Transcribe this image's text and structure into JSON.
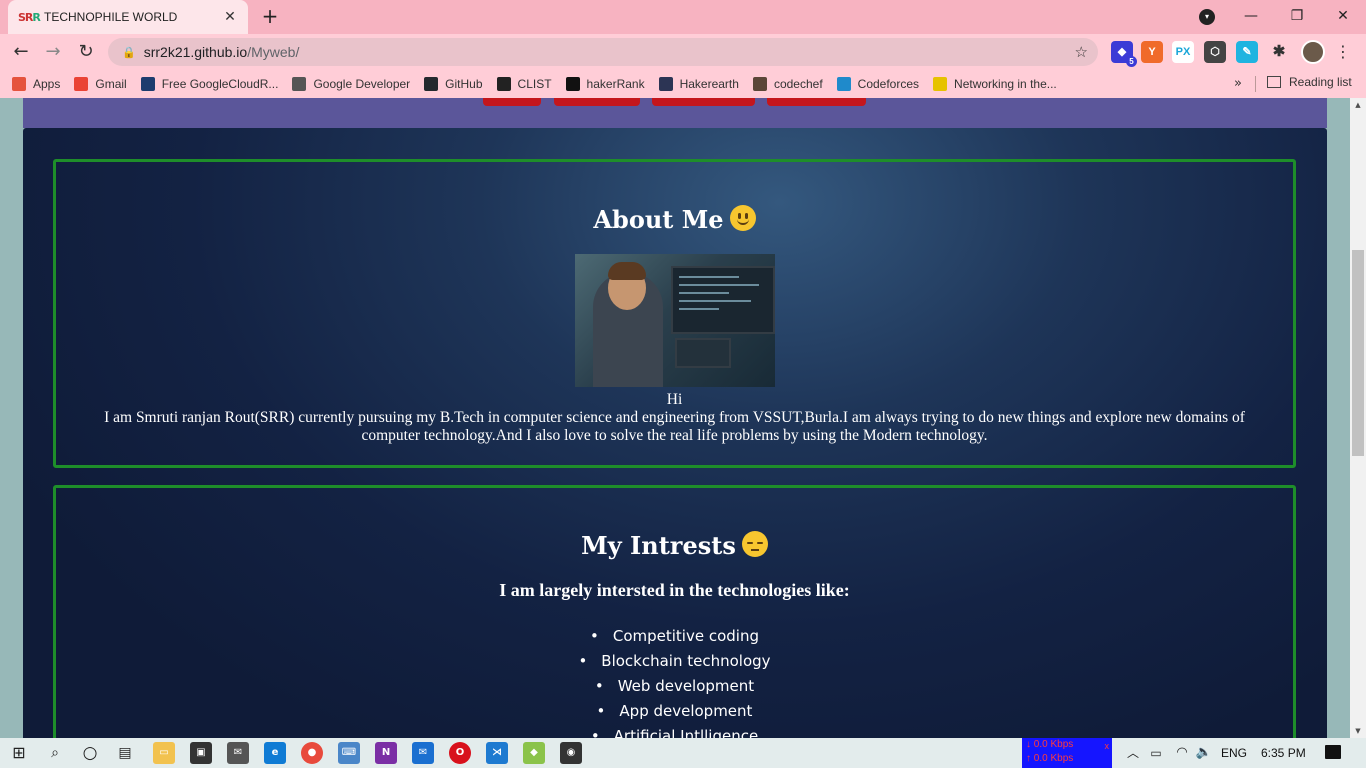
{
  "browser": {
    "tab_title": "TECHNOPHILE WORLD",
    "tab_favicon": "SRR",
    "url_host": "srr2k21.github.io",
    "url_path": "/Myweb/",
    "extension_badge": "5",
    "reading_list_label": "Reading list",
    "bookmarks": [
      {
        "label": "Apps",
        "icon": "apps-grid-icon",
        "color": "#e5533d"
      },
      {
        "label": "Gmail",
        "icon": "gmail-icon",
        "color": "#ea4335"
      },
      {
        "label": "Free GoogleCloudR...",
        "icon": "google-cloud-icon",
        "color": "#1d3c6e"
      },
      {
        "label": "Google Developer",
        "icon": "google-developers-icon",
        "color": "#555555"
      },
      {
        "label": "GitHub",
        "icon": "github-icon",
        "color": "#24292e"
      },
      {
        "label": "CLIST",
        "icon": "clist-icon",
        "color": "#222222"
      },
      {
        "label": "hakerRank",
        "icon": "hackerrank-icon",
        "color": "#111111"
      },
      {
        "label": "Hakerearth",
        "icon": "hackerearth-icon",
        "color": "#2c3454"
      },
      {
        "label": "codechef",
        "icon": "codechef-icon",
        "color": "#5b4638"
      },
      {
        "label": "Codeforces",
        "icon": "codeforces-icon",
        "color": "#1f8acb"
      },
      {
        "label": "Networking in the...",
        "icon": "networking-icon",
        "color": "#e6c200"
      }
    ]
  },
  "page": {
    "about": {
      "title": "About Me",
      "greeting": "Hi",
      "body": "I am Smruti ranjan Rout(SRR) currently pursuing my B.Tech in computer science and engineering from VSSUT,Burla.I am always trying to do new things and explore new domains of computer technology.And I also love to solve the real life problems by using the Modern technology."
    },
    "interests": {
      "title": "My Intrests",
      "subtitle": "I am largely intersted in the technologies like:",
      "items": [
        "Competitive coding",
        "Blockchain technology",
        "Web development",
        "App development",
        "Artificial Intlligence"
      ]
    }
  },
  "taskbar": {
    "net_down": "↓ 0.0 Kbps",
    "net_up": "↑ 0.0 Kbps",
    "language": "ENG",
    "time": "6:35 PM"
  },
  "colors": {
    "titlebar": "#f7b3c1",
    "section_border": "#1e8e2a",
    "nav_button": "#c4161c",
    "header_band": "#5b569a"
  }
}
